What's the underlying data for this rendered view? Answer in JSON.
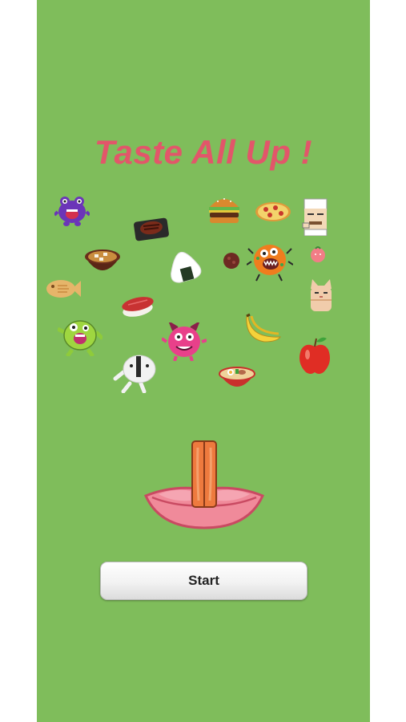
{
  "game": {
    "title": "Taste All Up !",
    "start_label": "Start",
    "background_color": "#7fbd5b",
    "title_color": "#e2566a"
  },
  "sprites": [
    "purple-monster-icon",
    "steak-icon",
    "hamburger-icon",
    "pizza-icon",
    "chef-icon",
    "miso-soup-icon",
    "onigiri-icon",
    "meatball-icon",
    "orange-monster-icon",
    "peach-icon",
    "taiyaki-icon",
    "tuna-sushi-icon",
    "cat-icon",
    "green-monster-icon",
    "banana-icon",
    "pink-monster-icon",
    "apple-icon",
    "white-creature-icon",
    "ramen-icon"
  ],
  "player": [
    "lips-icon",
    "tongue-icon"
  ]
}
